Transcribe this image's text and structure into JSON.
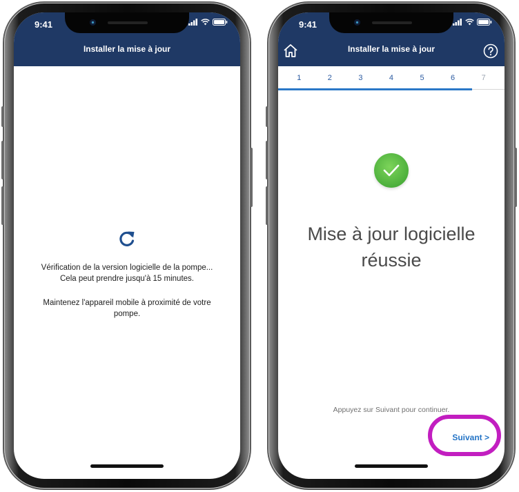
{
  "left_screen": {
    "status": {
      "time": "9:41"
    },
    "appbar": {
      "title": "Installer la mise à jour"
    },
    "icons": {
      "refresh": "refresh-icon"
    },
    "message_line1": "Vérification de la version logicielle de la pompe...",
    "message_line2": "Cela peut prendre jusqu'à 15 minutes.",
    "advice_line1": "Maintenez l'appareil mobile à proximité de votre",
    "advice_line2": "pompe."
  },
  "right_screen": {
    "status": {
      "time": "9:41"
    },
    "appbar": {
      "title": "Installer la mise à jour",
      "home_icon": "home-icon",
      "help_icon": "help-icon"
    },
    "steps": [
      "1",
      "2",
      "3",
      "4",
      "5",
      "6",
      "7"
    ],
    "current_step": 6,
    "total_steps": 7,
    "success_icon": "checkmark-icon",
    "headline_line1": "Mise à jour logicielle",
    "headline_line2": "réussie",
    "hint": "Appuyez sur Suivant pour continuer.",
    "next_label": "Suivant >"
  },
  "colors": {
    "appbar": "#1f3965",
    "accent": "#2474c6",
    "success": "#4caf3c",
    "highlight": "#c21ec0"
  }
}
